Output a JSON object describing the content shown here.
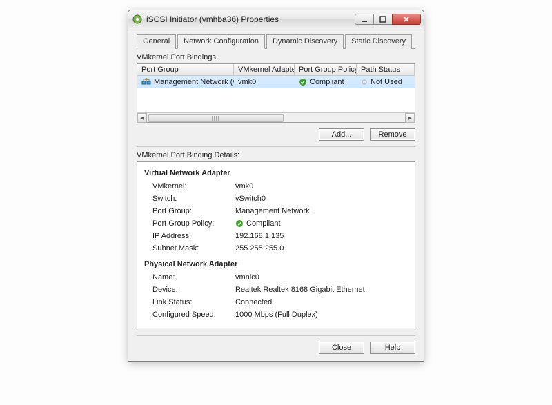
{
  "window": {
    "title": "iSCSI Initiator (vmhba36) Properties"
  },
  "tabs": {
    "general": "General",
    "network": "Network Configuration",
    "dynamic": "Dynamic Discovery",
    "static": "Static Discovery"
  },
  "bindings": {
    "label": "VMkernel Port Bindings:",
    "columns": {
      "port_group": "Port Group",
      "vmk_adapter": "VMkernel Adapter",
      "policy": "Port Group Policy",
      "path": "Path Status"
    },
    "rows": [
      {
        "port_group": "Management Network (v...",
        "vmk_adapter": "vmk0",
        "policy": "Compliant",
        "path": "Not Used"
      }
    ]
  },
  "buttons": {
    "add": "Add...",
    "remove": "Remove",
    "close": "Close",
    "help": "Help"
  },
  "details": {
    "label": "VMkernel Port Binding Details:",
    "virtual": {
      "title": "Virtual Network Adapter",
      "vmkernel_k": "VMkernel:",
      "vmkernel_v": "vmk0",
      "switch_k": "Switch:",
      "switch_v": "vSwitch0",
      "portgroup_k": "Port Group:",
      "portgroup_v": "Management Network",
      "policy_k": "Port Group Policy:",
      "policy_v": "Compliant",
      "ip_k": "IP Address:",
      "ip_v": "192.168.1.135",
      "mask_k": "Subnet Mask:",
      "mask_v": "255.255.255.0"
    },
    "physical": {
      "title": "Physical Network Adapter",
      "name_k": "Name:",
      "name_v": "vmnic0",
      "device_k": "Device:",
      "device_v": "Realtek Realtek 8168 Gigabit Ethernet",
      "link_k": "Link Status:",
      "link_v": "Connected",
      "speed_k": "Configured Speed:",
      "speed_v": "1000 Mbps (Full Duplex)"
    }
  }
}
